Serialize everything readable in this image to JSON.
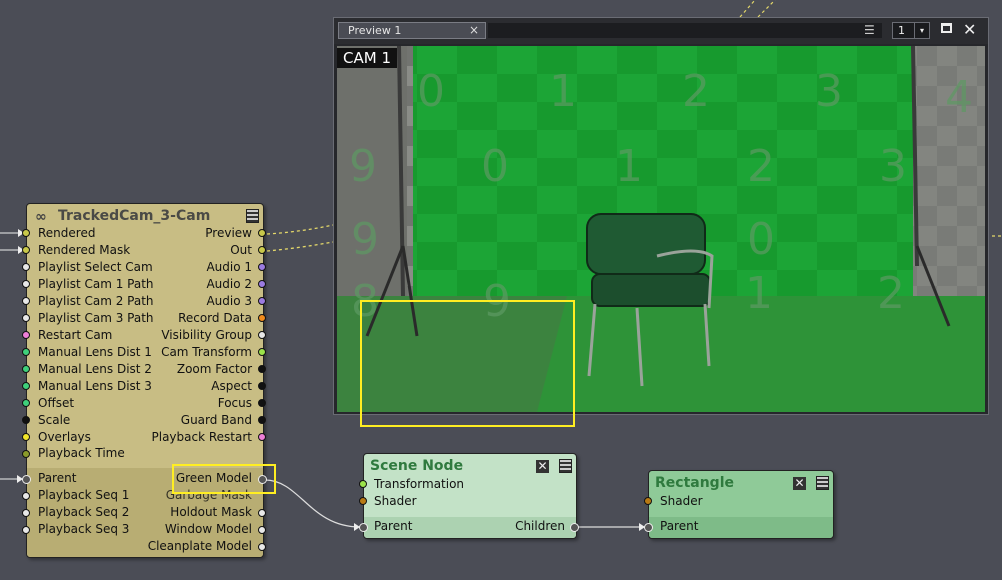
{
  "preview": {
    "tab_label": "Preview 1",
    "close_tab_glyph": "×",
    "menu_glyph": "☰",
    "view_number": "1",
    "dropdown_glyph": "▾",
    "close_glyph": "✕",
    "cam_label": "CAM 1",
    "backdrop_numbers": [
      "0",
      "1",
      "2",
      "3",
      "4",
      "9",
      "0",
      "1",
      "2",
      "3",
      "9",
      "0",
      "8",
      "9",
      "1",
      "2"
    ]
  },
  "tracked_node": {
    "title": "TrackedCam_3-Cam",
    "inputs": [
      "Rendered",
      "Rendered Mask",
      "Playlist Select Cam",
      "Playlist Cam 1 Path",
      "Playlist Cam 2 Path",
      "Playlist Cam 3 Path",
      "Restart Cam",
      "Manual Lens Dist 1",
      "Manual Lens Dist 2",
      "Manual Lens Dist 3",
      "Offset",
      "Scale",
      "Overlays",
      "Playback Time"
    ],
    "outputs": [
      "Preview",
      "Out",
      "Audio 1",
      "Audio 2",
      "Audio 3",
      "Record Data",
      "Visibility Group",
      "Cam Transform",
      "Zoom Factor",
      "Aspect",
      "Focus",
      "Guard Band",
      "Playback Restart"
    ],
    "parent_label": "Parent",
    "lower_inputs": [
      "Playback Seq 1",
      "Playback Seq 2",
      "Playback Seq 3"
    ],
    "lower_outputs": [
      "Green Model",
      "Garbage Mask",
      "Holdout Mask",
      "Window Model",
      "Cleanplate Model"
    ]
  },
  "scene_node": {
    "title": "Scene Node",
    "inputs": [
      "Transformation",
      "Shader"
    ],
    "parent_label": "Parent",
    "children_label": "Children"
  },
  "rect_node": {
    "title": "Rectangle",
    "inputs": [
      "Shader"
    ],
    "parent_label": "Parent"
  },
  "colors": {
    "tracked_node_bg": "#c8bd84",
    "scene_node_bg": "#c3e2c7",
    "rect_node_bg": "#8fca98",
    "highlight": "#ffee22",
    "canvas_bg": "#4b4d56"
  }
}
